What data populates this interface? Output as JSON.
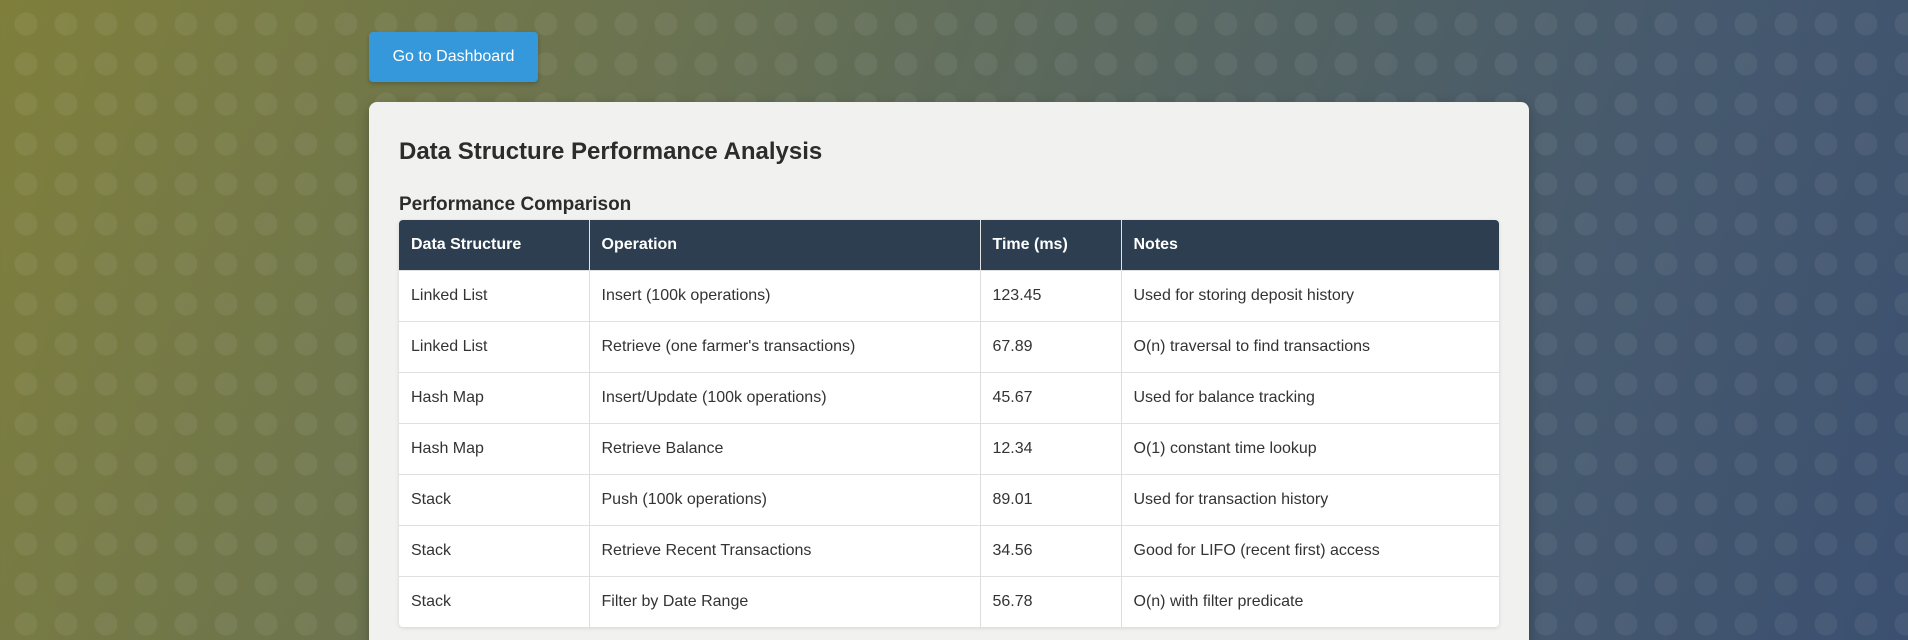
{
  "nav": {
    "dashboard_button": "Go to Dashboard"
  },
  "page": {
    "title": "Data Structure Performance Analysis",
    "section_title": "Performance Comparison"
  },
  "table": {
    "headers": [
      "Data Structure",
      "Operation",
      "Time (ms)",
      "Notes"
    ],
    "rows": [
      [
        "Linked List",
        "Insert (100k operations)",
        "123.45",
        "Used for storing deposit history"
      ],
      [
        "Linked List",
        "Retrieve (one farmer's transactions)",
        "67.89",
        "O(n) traversal to find transactions"
      ],
      [
        "Hash Map",
        "Insert/Update (100k operations)",
        "45.67",
        "Used for balance tracking"
      ],
      [
        "Hash Map",
        "Retrieve Balance",
        "12.34",
        "O(1) constant time lookup"
      ],
      [
        "Stack",
        "Push (100k operations)",
        "89.01",
        "Used for transaction history"
      ],
      [
        "Stack",
        "Retrieve Recent Transactions",
        "34.56",
        "Good for LIFO (recent first) access"
      ],
      [
        "Stack",
        "Filter by Date Range",
        "56.78",
        "O(n) with filter predicate"
      ]
    ]
  },
  "colors": {
    "button": "#3498db",
    "table_header": "#2c3e50",
    "card": "#f1f1ef"
  }
}
